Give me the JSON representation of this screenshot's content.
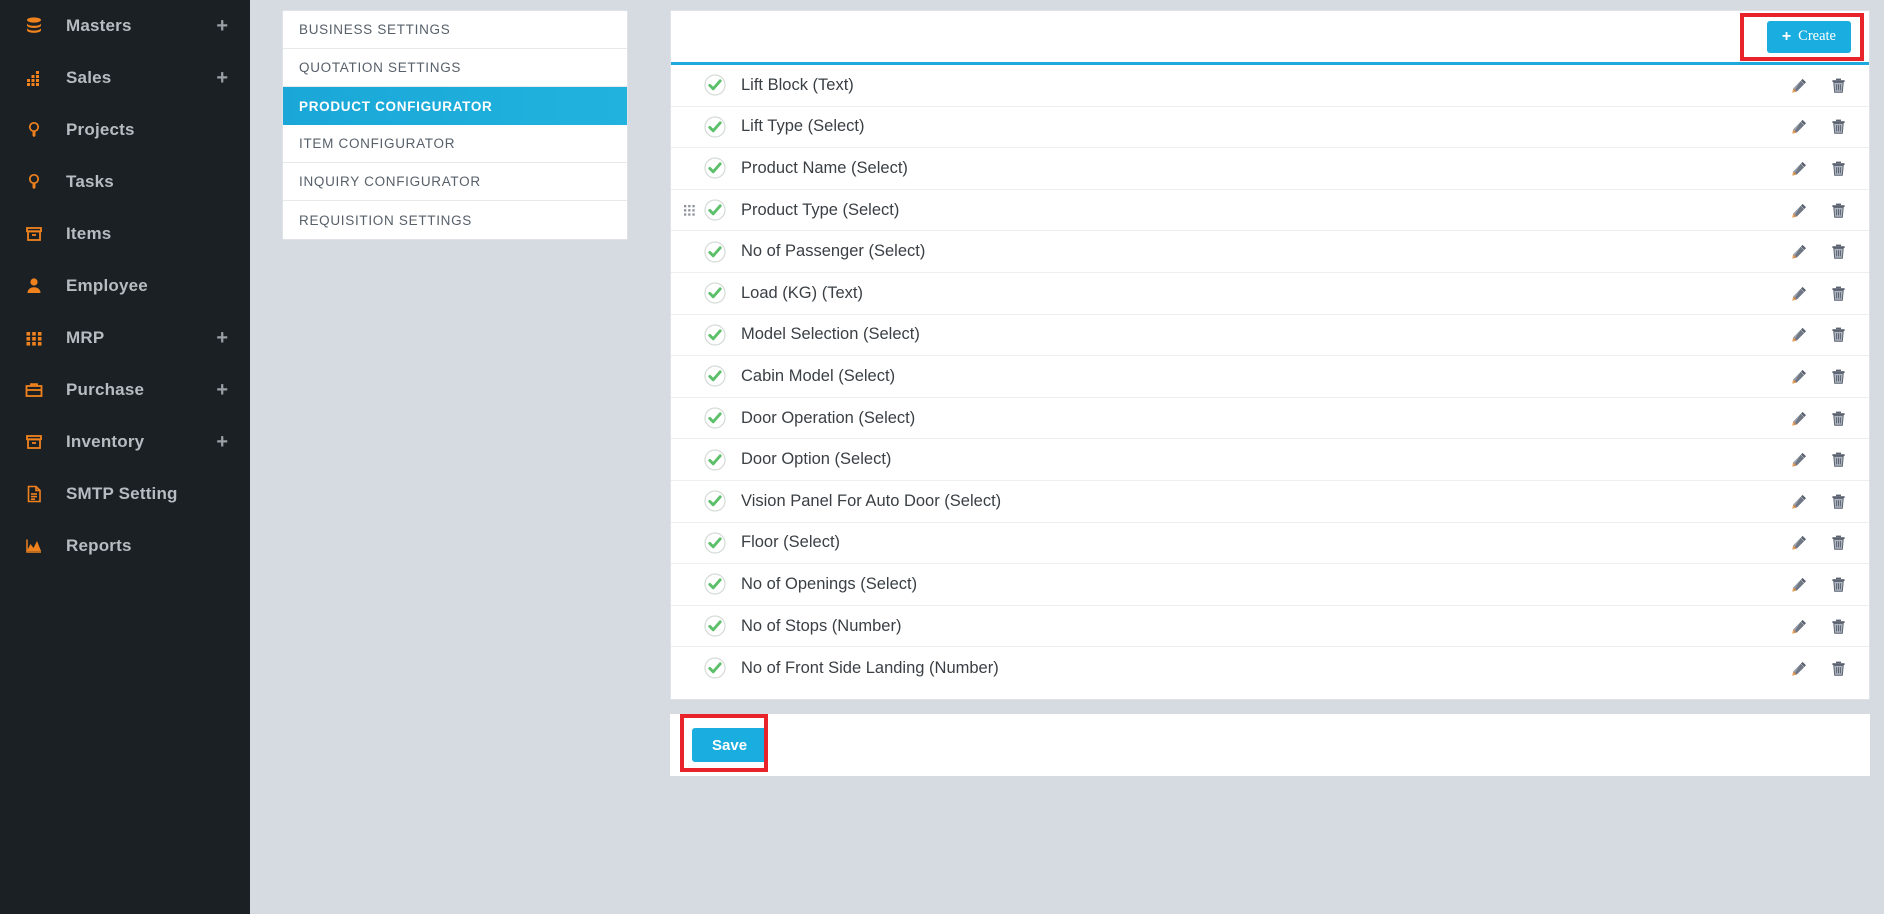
{
  "sidebar": {
    "items": [
      {
        "label": "Masters",
        "icon": "database-icon",
        "has_plus": true
      },
      {
        "label": "Sales",
        "icon": "bar-chart-icon",
        "has_plus": true
      },
      {
        "label": "Projects",
        "icon": "lightbulb-icon",
        "has_plus": false
      },
      {
        "label": "Tasks",
        "icon": "lightbulb-icon",
        "has_plus": false
      },
      {
        "label": "Items",
        "icon": "box-icon",
        "has_plus": false
      },
      {
        "label": "Employee",
        "icon": "user-icon",
        "has_plus": false
      },
      {
        "label": "MRP",
        "icon": "grid-icon",
        "has_plus": true
      },
      {
        "label": "Purchase",
        "icon": "briefcase-icon",
        "has_plus": true
      },
      {
        "label": "Inventory",
        "icon": "box-icon",
        "has_plus": true
      },
      {
        "label": "SMTP Setting",
        "icon": "document-icon",
        "has_plus": false
      },
      {
        "label": "Reports",
        "icon": "area-chart-icon",
        "has_plus": false
      }
    ],
    "plus_glyph": "+"
  },
  "settings_menu": {
    "items": [
      {
        "label": "BUSINESS SETTINGS",
        "active": false
      },
      {
        "label": "QUOTATION SETTINGS",
        "active": false
      },
      {
        "label": "PRODUCT CONFIGURATOR",
        "active": true
      },
      {
        "label": "ITEM CONFIGURATOR",
        "active": false
      },
      {
        "label": "INQUIRY CONFIGURATOR",
        "active": false
      },
      {
        "label": "REQUISITION SETTINGS",
        "active": false
      }
    ]
  },
  "panel": {
    "create_label": "Create",
    "create_plus": "+",
    "rows": [
      {
        "label": "Lift Block (Text)",
        "checked": true,
        "drag": false
      },
      {
        "label": "Lift Type (Select)",
        "checked": true,
        "drag": false
      },
      {
        "label": "Product Name (Select)",
        "checked": true,
        "drag": false
      },
      {
        "label": "Product Type (Select)",
        "checked": true,
        "drag": true
      },
      {
        "label": "No of Passenger (Select)",
        "checked": true,
        "drag": false
      },
      {
        "label": "Load (KG) (Text)",
        "checked": true,
        "drag": false
      },
      {
        "label": "Model Selection (Select)",
        "checked": true,
        "drag": false
      },
      {
        "label": "Cabin Model (Select)",
        "checked": true,
        "drag": false
      },
      {
        "label": "Door Operation (Select)",
        "checked": true,
        "drag": false
      },
      {
        "label": "Door Option (Select)",
        "checked": true,
        "drag": false
      },
      {
        "label": "Vision Panel For Auto Door (Select)",
        "checked": true,
        "drag": false
      },
      {
        "label": "Floor (Select)",
        "checked": true,
        "drag": false
      },
      {
        "label": "No of Openings (Select)",
        "checked": true,
        "drag": false
      },
      {
        "label": "No of Stops (Number)",
        "checked": true,
        "drag": false
      },
      {
        "label": "No of Front Side Landing (Number)",
        "checked": true,
        "drag": false
      }
    ],
    "row_icons": {
      "edit": "pencil-icon",
      "delete": "trash-icon",
      "drag": "drag-handle-icon",
      "status": "check-circle-icon"
    }
  },
  "footer": {
    "save_label": "Save"
  },
  "colors": {
    "sidebar_bg": "#1b2025",
    "sidebar_icon": "#f0821e",
    "sidebar_text": "#b6bcc2",
    "accent_blue": "#1aaddf",
    "active_menu": "#1aa7d8",
    "check_green": "#5cbf6a",
    "highlight_red": "#e8232a",
    "page_bg": "#d6dbe2"
  }
}
